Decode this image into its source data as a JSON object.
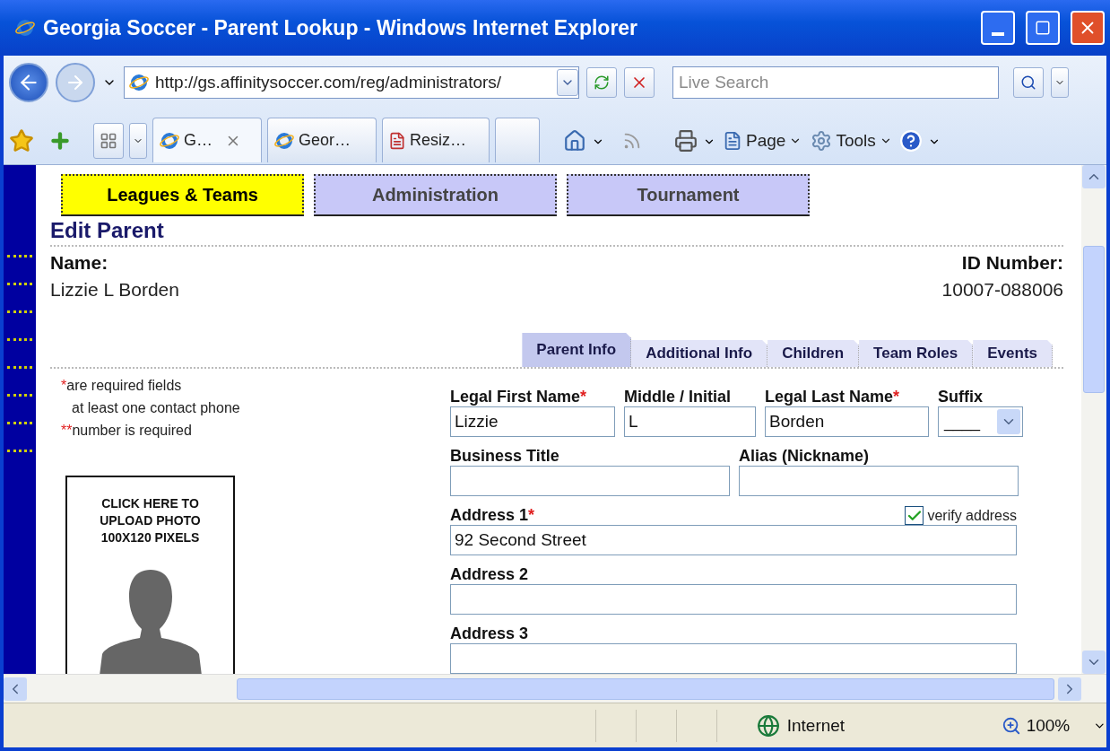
{
  "window": {
    "title": "Georgia Soccer - Parent Lookup - Windows Internet Explorer"
  },
  "address_bar": {
    "url": "http://gs.affinitysoccer.com/reg/administrators/"
  },
  "search": {
    "placeholder": "Live Search"
  },
  "browser_tabs": [
    {
      "label": "G…",
      "selected": true
    },
    {
      "label": "Geor…",
      "selected": false
    },
    {
      "label": "Resiz…",
      "selected": false
    }
  ],
  "commands": [
    {
      "label": "Page",
      "kind": "page"
    },
    {
      "label": "Tools",
      "kind": "tools"
    }
  ],
  "nav": [
    {
      "label": "Leagues & Teams",
      "selected": true
    },
    {
      "label": "Administration",
      "selected": false
    },
    {
      "label": "Tournament",
      "selected": false
    }
  ],
  "heading": "Edit Parent",
  "name": {
    "label": "Name:",
    "value": "Lizzie L Borden"
  },
  "id_number": {
    "label": "ID Number:",
    "value": "10007-088006"
  },
  "form_tabs": [
    {
      "label": "Parent Info",
      "selected": true
    },
    {
      "label": "Additional Info",
      "selected": false
    },
    {
      "label": "Children",
      "selected": false
    },
    {
      "label": "Team Roles",
      "selected": false
    },
    {
      "label": "Events",
      "selected": false
    }
  ],
  "notes": [
    {
      "mark": "*",
      "text": "are required fields"
    },
    {
      "text": "at least one contact phone"
    },
    {
      "mark": "**",
      "text": "number is required"
    }
  ],
  "photo": {
    "lines": [
      "CLICK HERE TO",
      "UPLOAD PHOTO",
      "100X120 PIXELS"
    ]
  },
  "field_rows": [
    [
      {
        "label": "Legal First Name",
        "required": true,
        "kind": "text",
        "value": "Lizzie"
      },
      {
        "label": "Middle / Initial",
        "required": false,
        "kind": "text",
        "value": "L"
      },
      {
        "label": "Legal Last Name",
        "required": true,
        "kind": "text",
        "value": "Borden"
      },
      {
        "label": "Suffix",
        "required": false,
        "kind": "select",
        "value": "____"
      }
    ],
    [
      {
        "label": "Business Title",
        "required": false,
        "kind": "text"
      },
      {
        "label": "Alias (Nickname)",
        "required": false,
        "kind": "text"
      }
    ],
    [
      {
        "label": "Address 1",
        "required": true,
        "kind": "text",
        "value": "92 Second Street",
        "verify": {
          "label": "verify address",
          "checked": true
        }
      }
    ],
    [
      {
        "label": "Address 2",
        "required": false,
        "kind": "text"
      }
    ],
    [
      {
        "label": "Address 3",
        "required": false,
        "kind": "text"
      }
    ]
  ],
  "status_bar": {
    "zone": "Internet",
    "zoom": "100%"
  }
}
